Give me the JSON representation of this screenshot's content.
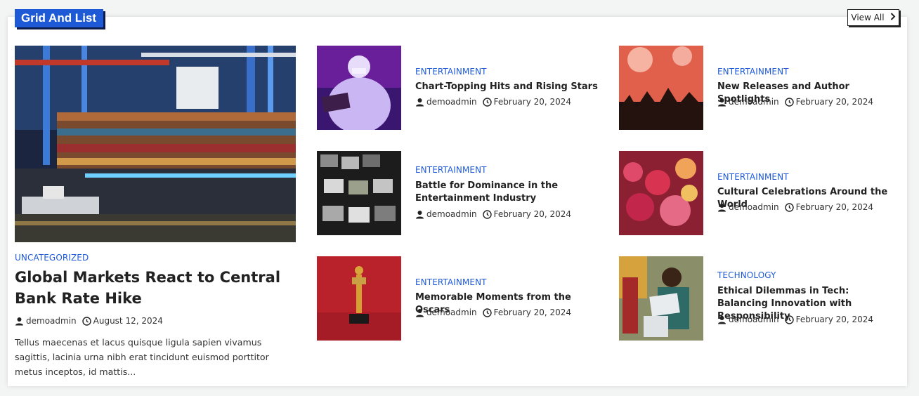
{
  "section": {
    "title": "Grid And List",
    "view_all": "View All"
  },
  "featured": {
    "category": "UNCATEGORIZED",
    "title": "Global Markets React to Central Bank Rate Hike",
    "author": "demoadmin",
    "date": "August 12, 2024",
    "excerpt": "Tellus maecenas et lacus quisque ligula sapien vivamus sagittis, lacinia urna nibh erat tincidunt euismod porttitor metus inceptos, id mattis..."
  },
  "posts": [
    {
      "category": "ENTERTAINMENT",
      "title": "Chart-Topping Hits and Rising Stars",
      "author": "demoadmin",
      "date": "February 20, 2024"
    },
    {
      "category": "ENTERTAINMENT",
      "title": "Battle for Dominance in the Entertainment Industry",
      "author": "demoadmin",
      "date": "February 20, 2024"
    },
    {
      "category": "ENTERTAINMENT",
      "title": "Memorable Moments from the Oscars",
      "author": "demoadmin",
      "date": "February 20, 2024"
    },
    {
      "category": "ENTERTAINMENT",
      "title": "New Releases and Author Spotlights",
      "author": "demoadmin",
      "date": "February 20, 2024"
    },
    {
      "category": "ENTERTAINMENT",
      "title": "Cultural Celebrations Around the World",
      "author": "demoadmin",
      "date": "February 20, 2024"
    },
    {
      "category": "TECHNOLOGY",
      "title": "Ethical Dilemmas in Tech: Balancing Innovation with Responsibility",
      "author": "demoadmin",
      "date": "February 20, 2024"
    }
  ],
  "colors": {
    "accent": "#1e5ad6",
    "title_text": "#222222",
    "background": "#f3f4f4"
  }
}
